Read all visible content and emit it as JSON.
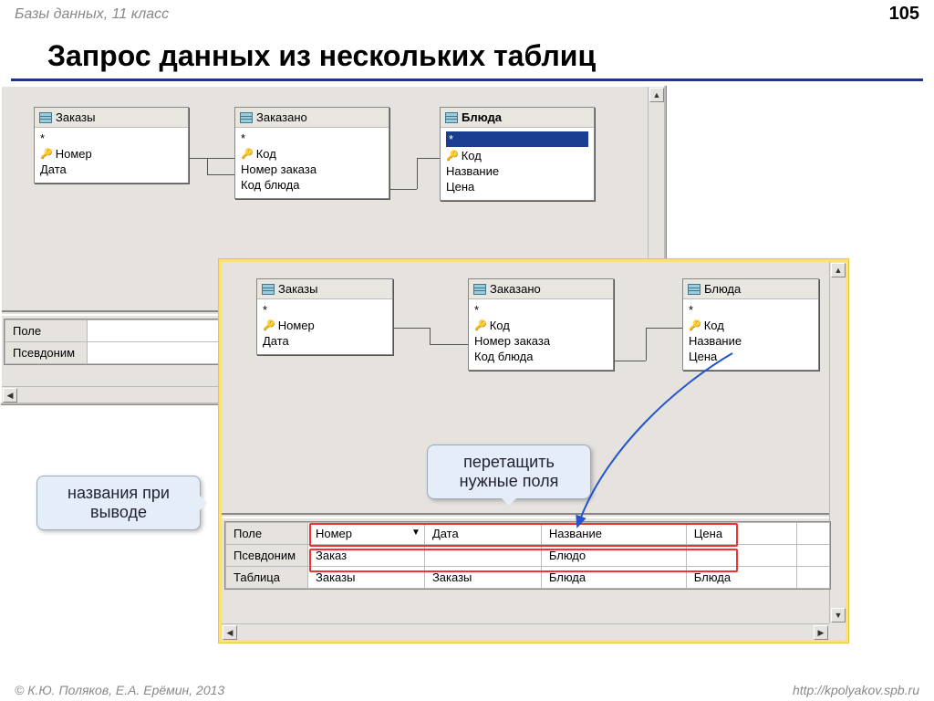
{
  "header": {
    "topic": "Базы данных, 11 класс",
    "page": "105"
  },
  "title": "Запрос данных из нескольких таблиц",
  "footer": {
    "copyright": "© К.Ю. Поляков, Е.А. Ерёмин, 2013",
    "url": "http://kpolyakov.spb.ru"
  },
  "tables": {
    "orders": {
      "title": "Заказы",
      "star": "*",
      "fields": [
        "Номер",
        "Дата"
      ],
      "keys": [
        0
      ]
    },
    "ordered": {
      "title": "Заказано",
      "star": "*",
      "fields": [
        "Код",
        "Номер заказа",
        "Код блюда"
      ],
      "keys": [
        0
      ]
    },
    "dishes": {
      "title": "Блюда",
      "star": "*",
      "fields": [
        "Код",
        "Название",
        "Цена"
      ],
      "keys": [
        0
      ]
    }
  },
  "grid_back": {
    "row_labels": [
      "Поле",
      "Псевдоним"
    ]
  },
  "grid_front": {
    "row_labels": [
      "Поле",
      "Псевдоним",
      "Таблица"
    ],
    "columns": [
      {
        "field": "Номер",
        "alias": "Заказ",
        "table": "Заказы"
      },
      {
        "field": "Дата",
        "alias": "",
        "table": "Заказы"
      },
      {
        "field": "Название",
        "alias": "Блюдо",
        "table": "Блюда"
      },
      {
        "field": "Цена",
        "alias": "",
        "table": "Блюда"
      },
      {
        "field": "",
        "alias": "",
        "table": ""
      }
    ]
  },
  "callouts": {
    "aliases": "названия при\nвыводе",
    "drag": "перетащить\nнужные поля"
  }
}
